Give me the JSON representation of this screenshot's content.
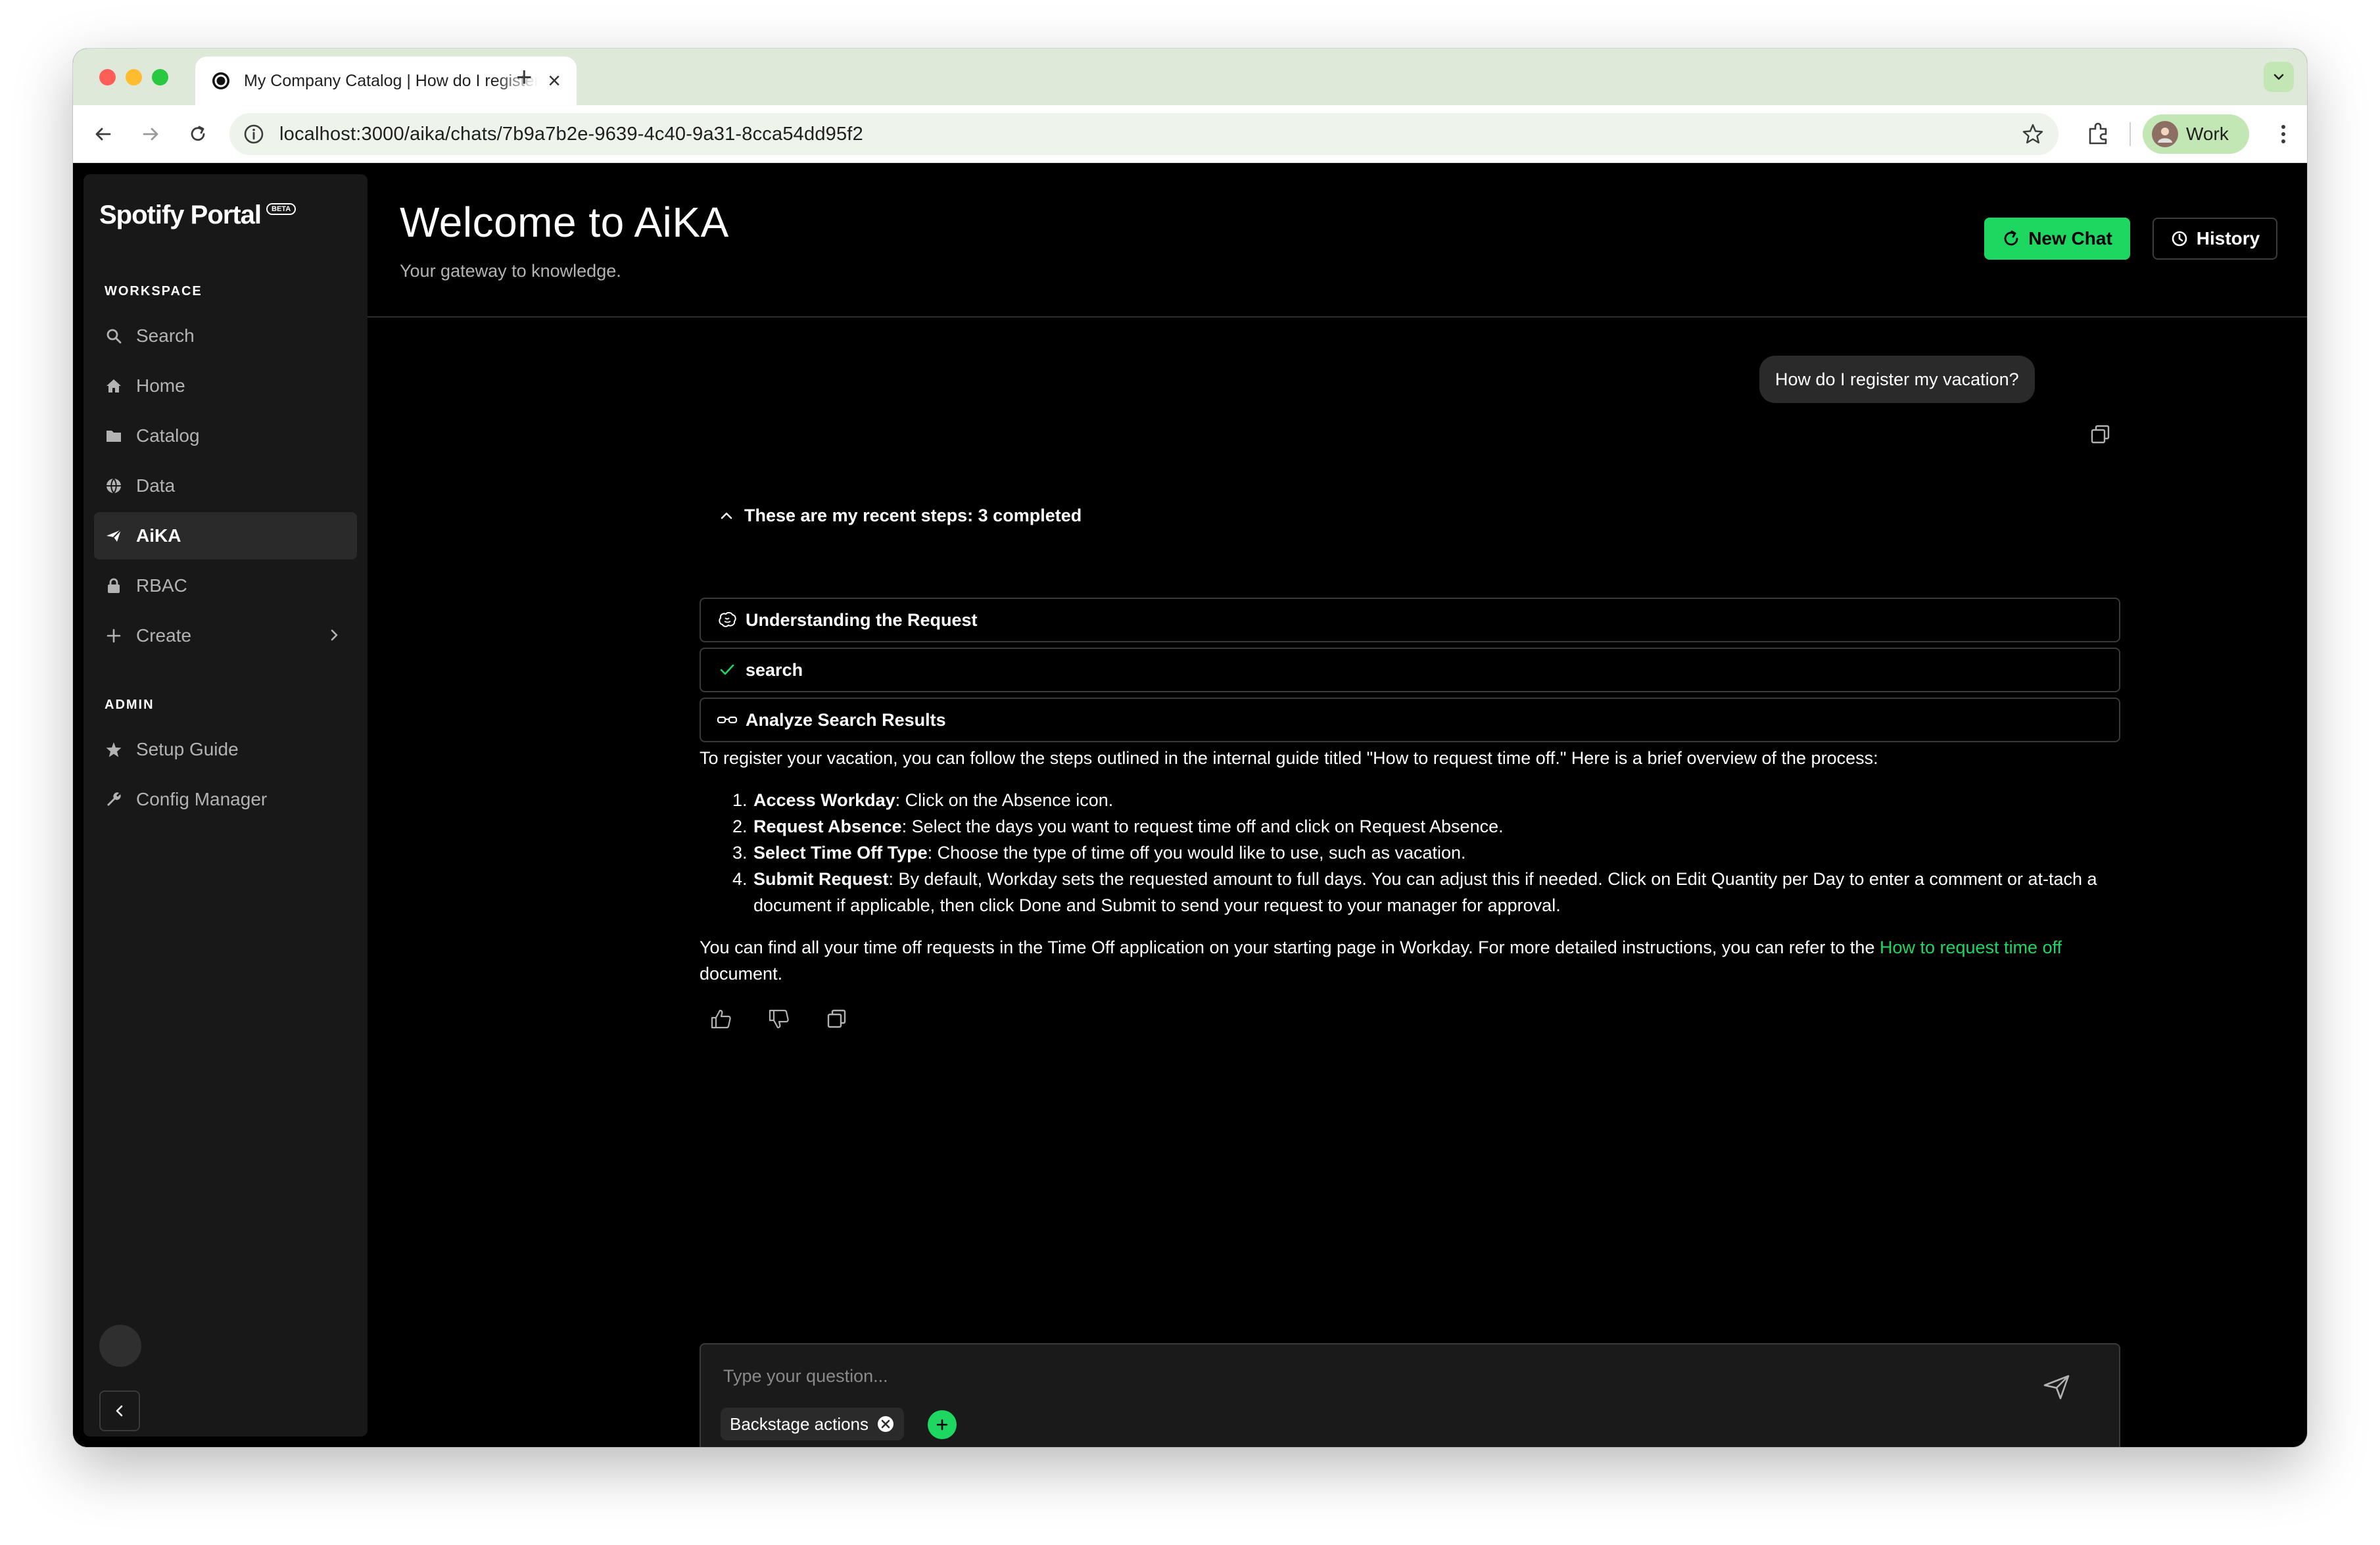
{
  "browser": {
    "tab_title": "My Company Catalog | How do I register my vacation?",
    "new_tab_symbol": "+",
    "url": "localhost:3000/aika/chats/7b9a7b2e-9639-4c40-9a31-8cca54dd95f2",
    "profile_name": "Work"
  },
  "sidebar": {
    "logo": "Spotify Portal",
    "logo_badge": "BETA",
    "workspace_label": "WORKSPACE",
    "items": [
      {
        "label": "Search",
        "icon": "search-icon"
      },
      {
        "label": "Home",
        "icon": "home-icon"
      },
      {
        "label": "Catalog",
        "icon": "folder-icon"
      },
      {
        "label": "Data",
        "icon": "globe-icon"
      },
      {
        "label": "AiKA",
        "icon": "plane-icon",
        "active": true
      },
      {
        "label": "RBAC",
        "icon": "lock-icon"
      },
      {
        "label": "Create",
        "icon": "plus-icon"
      }
    ],
    "admin_label": "ADMIN",
    "admin_items": [
      {
        "label": "Setup Guide",
        "icon": "star-icon"
      },
      {
        "label": "Config Manager",
        "icon": "wrench-icon"
      }
    ]
  },
  "header": {
    "title": "Welcome to AiKA",
    "subtitle": "Your gateway to knowledge.",
    "new_chat_label": "New Chat",
    "history_label": "History"
  },
  "chat": {
    "user_message": "How do I register my vacation?",
    "steps_header": "These are my recent steps: 3 completed",
    "steps": [
      {
        "label": "Understanding the Request",
        "icon": "brain-icon"
      },
      {
        "label": "search",
        "icon": "check-icon"
      },
      {
        "label": "Analyze Search Results",
        "icon": "glasses-icon"
      }
    ],
    "intro": "To register your vacation, you can follow the steps outlined in the internal guide titled \"How to request time off.\" Here is a brief overview of the process:",
    "list": [
      {
        "title": "Access Workday",
        "text": ": Click on the Absence icon."
      },
      {
        "title": "Request Absence",
        "text": ": Select the days you want to request time off and click on Request Absence."
      },
      {
        "title": "Select Time Off Type",
        "text": ": Choose the type of time off you would like to use, such as vacation."
      },
      {
        "title": "Submit Request",
        "text": ": By default, Workday sets the requested amount to full days. You can adjust this if needed. Click on Edit Quantity per Day to enter a comment or at-tach a document if applicable, then click Done and Submit to send your request to your manager for approval."
      }
    ],
    "outro_before": "You can find all your time off requests in the Time Off application on your starting page in Workday. For more detailed instructions, you can refer to the ",
    "outro_link": "How to request time off",
    "outro_after": " document."
  },
  "composer": {
    "placeholder": "Type your question...",
    "chip_label": "Backstage actions"
  },
  "colors": {
    "accent": "#1ed760",
    "background": "#000000",
    "sidebar": "#181818"
  }
}
